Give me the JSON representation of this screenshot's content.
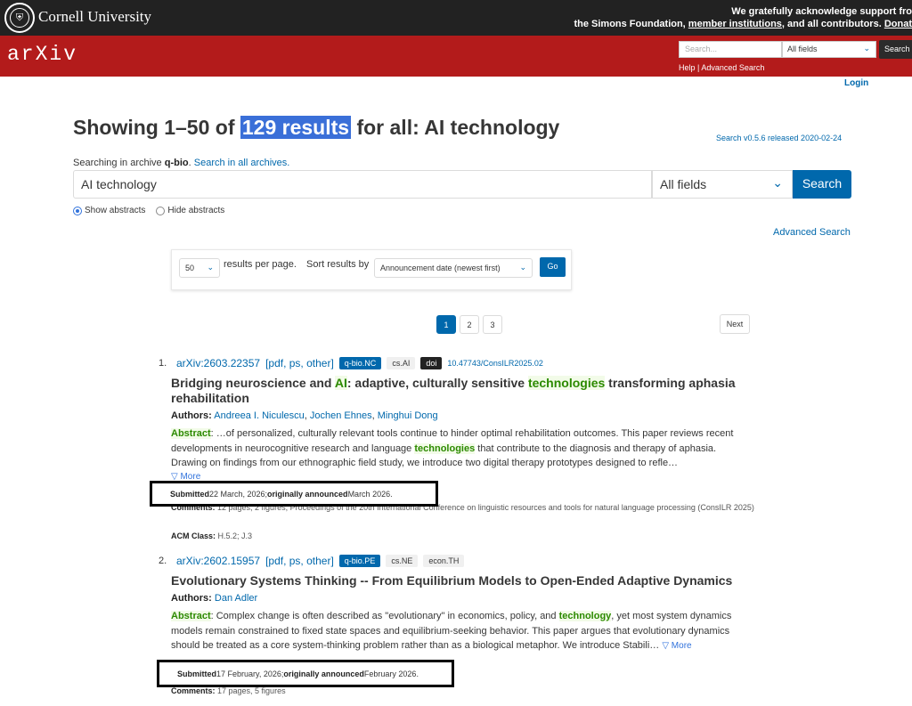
{
  "topbar": {
    "university": "Cornell University",
    "support_line1": "We gratefully acknowledge support fro",
    "support_line2_pre": "the Simons Foundation, ",
    "support_link_members": "member institutions",
    "support_line2_mid": ", and all contributors. ",
    "support_link_donate": "Donat"
  },
  "header": {
    "logo": "arXiv",
    "search_placeholder": "Search...",
    "field_select": "All fields",
    "search_button": "Search",
    "help_link": "Help",
    "separator": " | ",
    "advanced_link": "Advanced Search",
    "login": "Login"
  },
  "page": {
    "title_pre": "Showing 1–50 of ",
    "title_highlight": "129 results",
    "title_post": " for all: AI technology",
    "version": "Search v0.5.6 released 2020-02-24",
    "archive_pre": "Searching in archive ",
    "archive_name": "q-bio",
    "archive_sep": ". ",
    "archive_link": "Search in all archives.",
    "query_value": "AI technology",
    "field_value": "All fields",
    "search_button": "Search",
    "show_abstracts": "Show abstracts",
    "hide_abstracts": "Hide abstracts",
    "advanced_search": "Advanced Search"
  },
  "controls": {
    "per_page": "50",
    "per_page_label": "results per page.",
    "sort_label": "Sort results by",
    "sort_value": "Announcement date (newest first)",
    "go": "Go"
  },
  "pagination": {
    "pages": [
      "1",
      "2",
      "3"
    ],
    "current": "1",
    "next": "Next"
  },
  "results": [
    {
      "num": "1.",
      "id": "arXiv:2603.22357",
      "links": "[pdf, ps, other]",
      "primary_tag": "q-bio.NC",
      "tags": [
        "cs.AI"
      ],
      "doi_label": "doi",
      "doi_value": "10.47743/ConsILR2025.02",
      "title_parts": [
        "Bridging neuroscience and ",
        "AI",
        ": adaptive, culturally sensitive ",
        "technologies",
        " transforming aphasia rehabilitation"
      ],
      "authors_label": "Authors:",
      "authors": [
        "Andreea I. Niculescu",
        "Jochen Ehnes",
        "Minghui Dong"
      ],
      "abstract_label": "Abstract",
      "abstract_parts": [
        ": …of personalized, culturally relevant tools continue to hinder optimal rehabilitation outcomes. This paper reviews recent developments in neurocognitive research and language ",
        "technologies",
        " that contribute to the diagnosis and therapy of aphasia. Drawing on findings from our ethnographic field study, we introduce two digital therapy prototypes designed to refle…"
      ],
      "more": "▽ More",
      "submitted_label": "Submitted",
      "submitted_date": " 22 March, 2026; ",
      "announced_label": "originally announced",
      "announced_date": " March 2026.",
      "comments_label": "Comments:",
      "comments": " 12 pages, 2 figures, Proceedings of the 20th International Conference on linguistic resources and tools for natural language processing (ConsILR 2025)",
      "acm_label": "ACM Class:",
      "acm": " H.5.2; J.3"
    },
    {
      "num": "2.",
      "id": "arXiv:2602.15957",
      "links": "[pdf, ps, other]",
      "primary_tag": "q-bio.PE",
      "tags": [
        "cs.NE",
        "econ.TH"
      ],
      "title": "Evolutionary Systems Thinking -- From Equilibrium Models to Open-Ended Adaptive Dynamics",
      "authors_label": "Authors:",
      "authors": [
        "Dan Adler"
      ],
      "abstract_label": "Abstract",
      "abstract_parts": [
        ": Complex change is often described as \"evolutionary\" in economics, policy, and ",
        "technology",
        ", yet most system dynamics models remain constrained to fixed state spaces and equilibrium-seeking behavior. This paper argues that evolutionary dynamics should be treated as a core system-thinking problem rather than as a biological metaphor. We introduce Stabili…"
      ],
      "more": "▽ More",
      "submitted_label": "Submitted",
      "submitted_date": " 17 February, 2026; ",
      "announced_label": "originally announced",
      "announced_date": " February 2026.",
      "comments_label": "Comments:",
      "comments": " 17 pages, 5 figures"
    }
  ]
}
